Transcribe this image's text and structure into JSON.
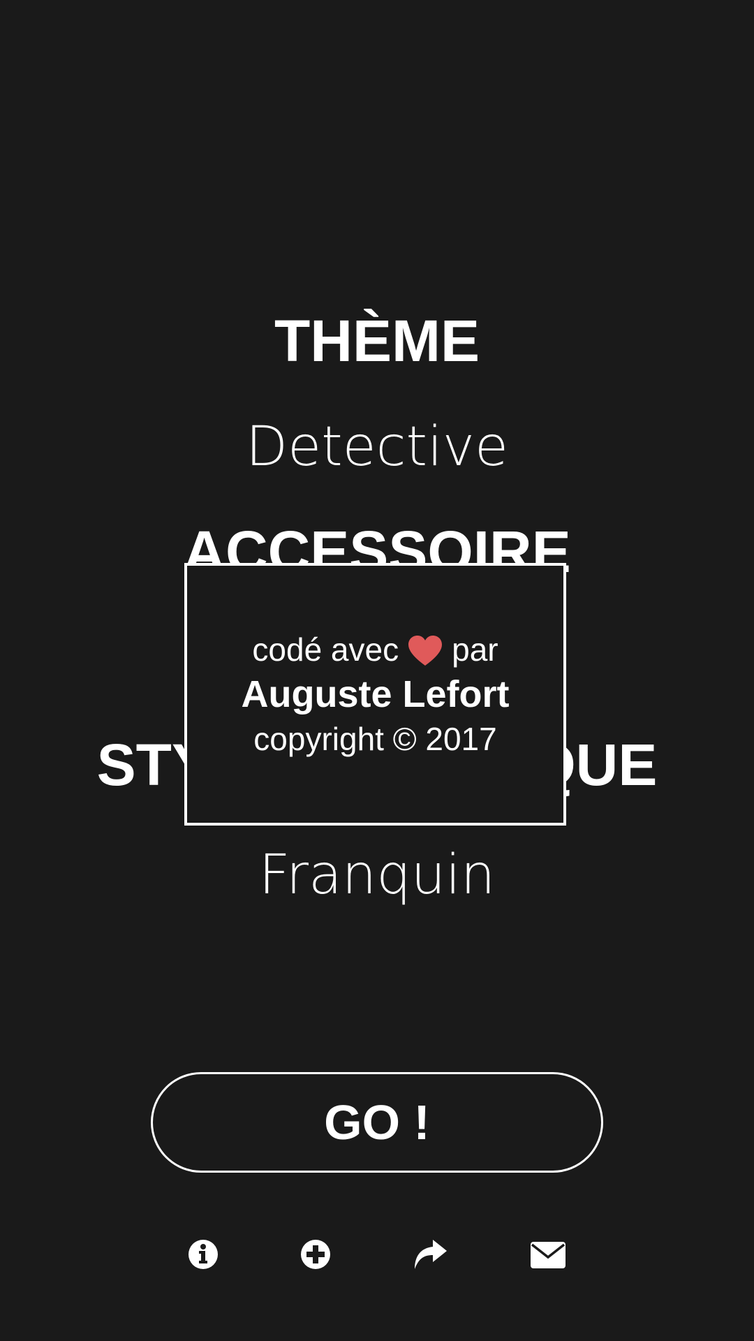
{
  "sections": {
    "theme": {
      "title": "THÈME",
      "value": "Detective"
    },
    "accessoire": {
      "title": "ACCESSOIRE",
      "value": ""
    },
    "style": {
      "title": "STYLE GRAPHIQUE",
      "value": "Franquin"
    }
  },
  "credits": {
    "line1_before": "codé avec",
    "heart_icon": "heart-icon",
    "heart_color": "#e05a5a",
    "line1_after": "par",
    "author": "Auguste Lefort",
    "copyright": "copyright © 2017"
  },
  "go_button": {
    "label": "GO !"
  },
  "bottom_icons": [
    "info-icon",
    "plus-circle-icon",
    "share-icon",
    "envelope-icon"
  ],
  "colors": {
    "background": "#1a1a1a",
    "foreground": "#ffffff",
    "accent": "#e05a5a"
  }
}
